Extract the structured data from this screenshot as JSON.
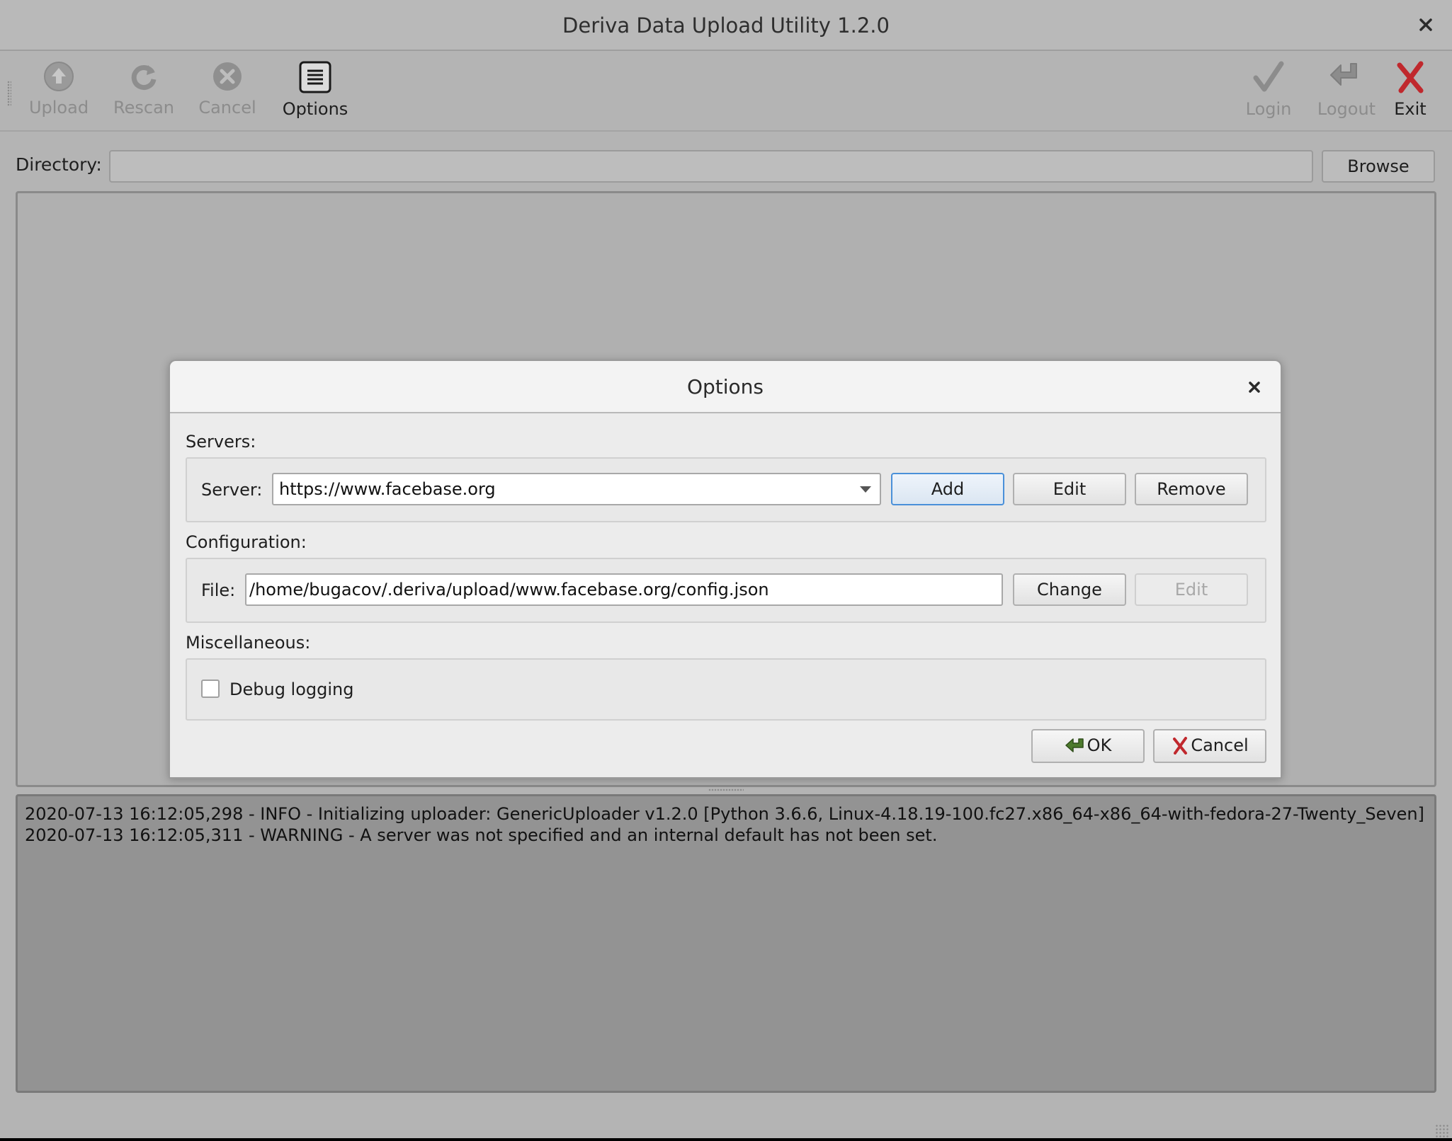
{
  "window": {
    "title": "Deriva Data Upload Utility 1.2.0"
  },
  "toolbar": {
    "upload": "Upload",
    "rescan": "Rescan",
    "cancel": "Cancel",
    "options": "Options",
    "login": "Login",
    "logout": "Logout",
    "exit": "Exit"
  },
  "directory": {
    "label": "Directory:",
    "value": "",
    "browse": "Browse"
  },
  "log": {
    "lines": [
      "2020-07-13 16:12:05,298 - INFO - Initializing uploader: GenericUploader v1.2.0 [Python 3.6.6, Linux-4.18.19-100.fc27.x86_64-x86_64-with-fedora-27-Twenty_Seven]",
      "2020-07-13 16:12:05,311 - WARNING - A server was not specified and an internal default has not been set."
    ]
  },
  "dialog": {
    "title": "Options",
    "servers_label": "Servers:",
    "server_label": "Server:",
    "server_value": "https://www.facebase.org",
    "add": "Add",
    "edit": "Edit",
    "remove": "Remove",
    "configuration_label": "Configuration:",
    "file_label": "File:",
    "file_value": "/home/bugacov/.deriva/upload/www.facebase.org/config.json",
    "change": "Change",
    "config_edit": "Edit",
    "misc_label": "Miscellaneous:",
    "debug_logging": "Debug logging",
    "debug_checked": false,
    "ok": "OK",
    "cancel": "Cancel"
  },
  "colors": {
    "exit_icon": "#c0282d",
    "default_button_border": "#4a90d9"
  },
  "icons": {
    "upload": "upload-arrow-icon",
    "rescan": "refresh-icon",
    "cancel": "cancel-circle-icon",
    "options": "options-list-icon",
    "login": "checkmark-icon",
    "logout": "logout-arrow-icon",
    "exit": "exit-x-icon"
  }
}
